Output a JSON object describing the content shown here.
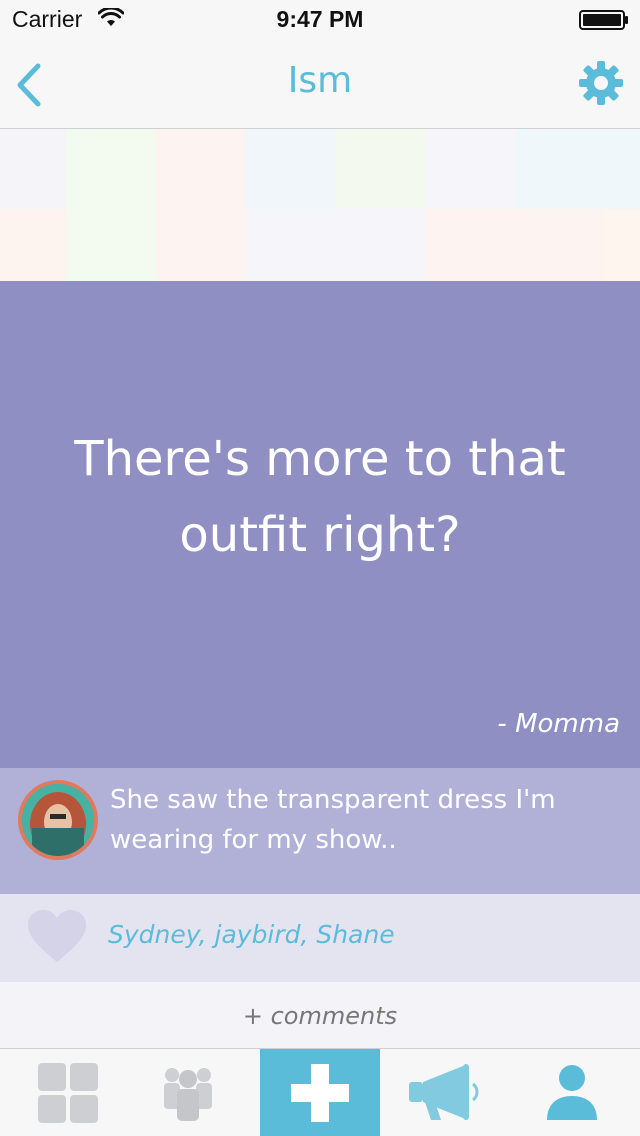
{
  "status_bar": {
    "carrier": "Carrier",
    "time": "9:47 PM",
    "icons": [
      "wifi-icon",
      "battery-icon"
    ]
  },
  "nav": {
    "title": "Ism",
    "back_icon": "chevron-left-icon",
    "settings_icon": "gear-icon"
  },
  "post": {
    "quote": "There's more to that outfit right?",
    "author": "- Momma",
    "story": "She saw the transparent dress I'm wearing for my show..",
    "likers": "Sydney, jaybird, Shane",
    "comments_label": "+ comments"
  },
  "tabs": [
    {
      "name": "grid",
      "icon": "grid-icon"
    },
    {
      "name": "friends",
      "icon": "group-icon"
    },
    {
      "name": "add",
      "icon": "plus-icon"
    },
    {
      "name": "announce",
      "icon": "megaphone-icon"
    },
    {
      "name": "profile",
      "icon": "person-icon"
    }
  ],
  "colors": {
    "accent": "#5bbcd9",
    "quote_bg": "#8f8fc3",
    "story_bg": "#b1b1d7",
    "likes_bg": "#e4e3f0",
    "avatar_border": "#e07a5f"
  }
}
